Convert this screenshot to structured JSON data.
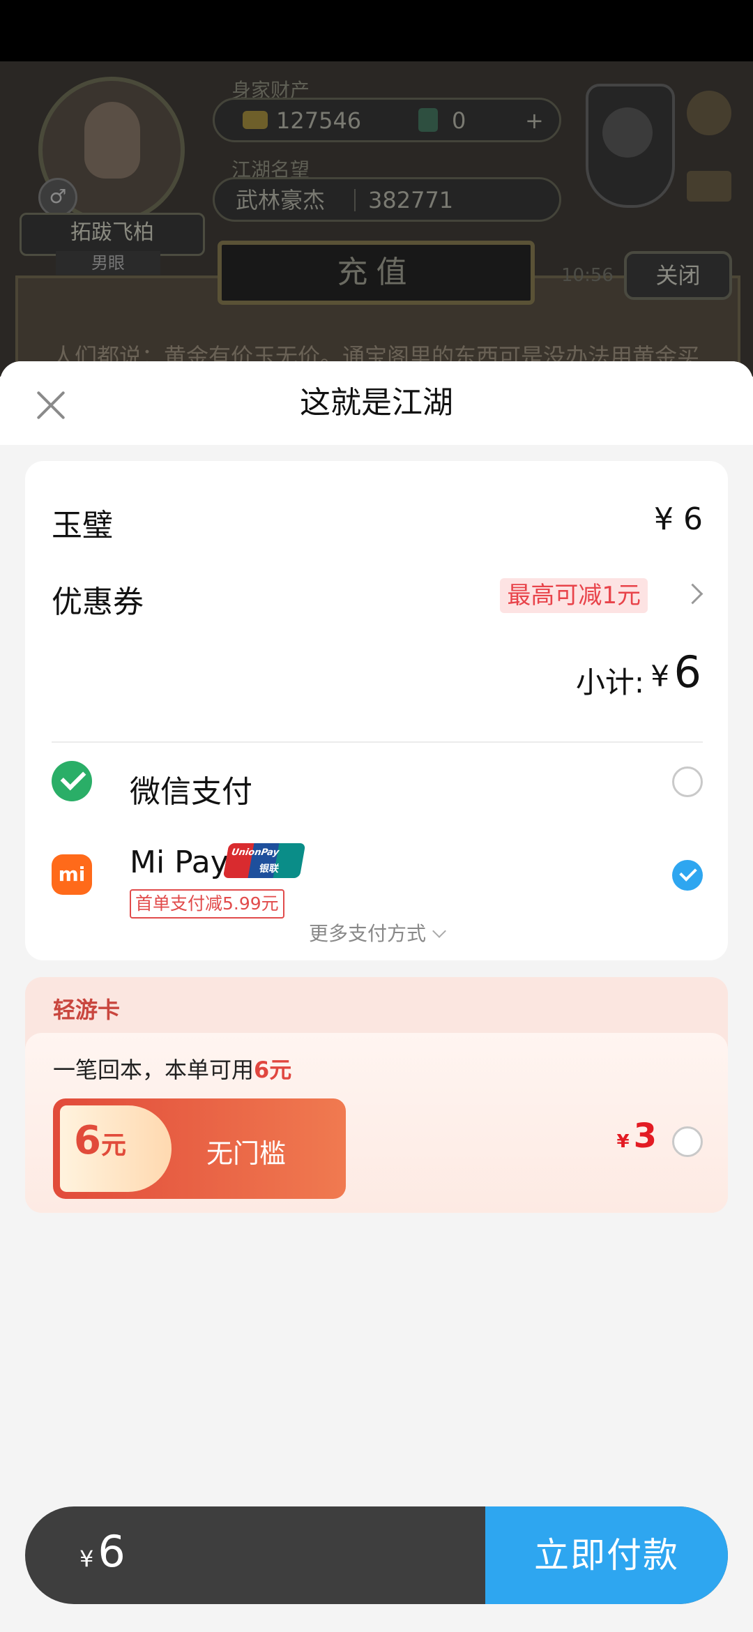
{
  "game": {
    "wealth_label": "身家财产",
    "gold_value": "127546",
    "jade_value": "0",
    "add_symbol": "+",
    "fame_label": "江湖名望",
    "fame_title": "武林豪杰",
    "fame_value": "382771",
    "player_name": "拓跋飞柏",
    "player_sub": "男眼",
    "recharge_title": "充值",
    "close_label": "关闭",
    "time_text": "10:56",
    "marquee": "人们都说：黄金有价玉无价。通宝阁里的东西可是没办法用黄金买"
  },
  "sheet": {
    "title": "这就是江湖"
  },
  "order": {
    "item_name": "玉璧",
    "item_price": "¥ 6",
    "coupon_label": "优惠券",
    "coupon_badge": "最高可减1元",
    "subtotal_label": "小计:",
    "subtotal_yen": "¥",
    "subtotal_value": "6"
  },
  "payment_methods": [
    {
      "name": "微信支付",
      "icon": "wechat-pay-icon",
      "selected": false
    },
    {
      "name": "Mi Pay",
      "icon": "mi-pay-icon",
      "selected": true,
      "promo": "首单支付减5.99元",
      "badge_text": "UnionPay",
      "badge_text_cn": "银联"
    }
  ],
  "more_payment_label": "更多支付方式",
  "card": {
    "title": "轻游卡",
    "desc_prefix": "一笔回本，本单可用",
    "desc_accent": "6元",
    "voucher_amount": "6",
    "voucher_unit": "元",
    "voucher_label": "无门槛",
    "price_yen": "¥",
    "price_value": "3"
  },
  "bottom": {
    "total_yen": "¥",
    "total_value": "6",
    "pay_button": "立即付款"
  },
  "colors": {
    "accent_blue": "#2ea6f0",
    "promo_red": "#e14b4b",
    "wechat_green": "#2aae67",
    "mi_orange": "#ff6a1a"
  }
}
